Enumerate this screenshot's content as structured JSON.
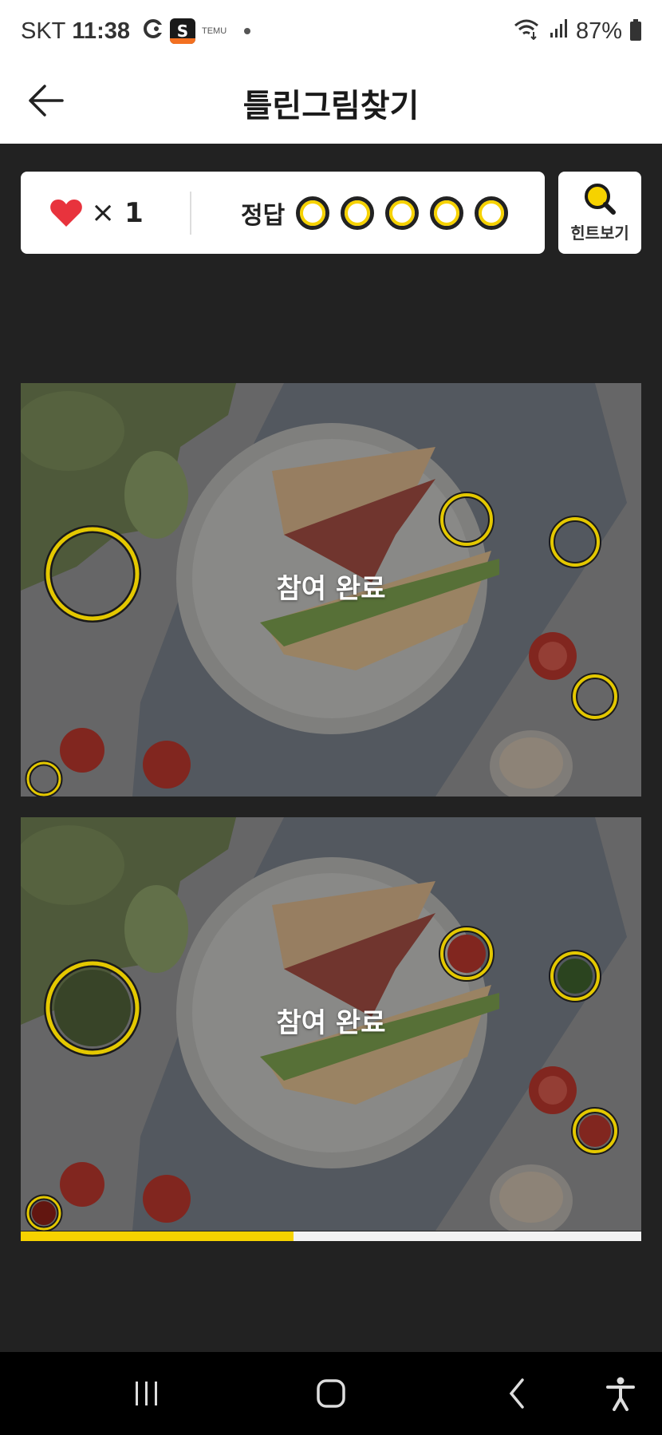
{
  "status_bar": {
    "carrier": "SKT",
    "time": "11:38",
    "temu_label": "TEMU",
    "battery": "87%"
  },
  "header": {
    "title": "틀린그림찾기"
  },
  "score": {
    "lives_symbol": "×",
    "lives_count": "1",
    "answers_label": "정답",
    "answers_total": 5
  },
  "hint": {
    "label": "힌트보기"
  },
  "puzzles": {
    "top_overlay": "참여 완료",
    "bottom_overlay": "참여 완료"
  },
  "progress": {
    "fraction": 0.44
  },
  "colors": {
    "accent": "#f6d200",
    "heart": "#e8333d",
    "background": "#222222"
  },
  "nav": {
    "recents": "recents-icon",
    "home": "home-icon",
    "back": "back-icon",
    "accessibility": "accessibility-icon"
  }
}
